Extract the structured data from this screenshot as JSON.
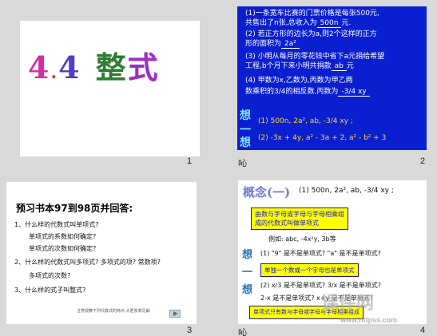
{
  "slides": [
    {
      "number": "1",
      "title_parts": [
        "4",
        ".",
        "4",
        "整",
        "式"
      ]
    },
    {
      "number": "2",
      "lines": [
        "(1)一条宽车比赛的门票价格是每张",
        "共售出了n张,总收入为",
        "(2) 若正方形的边长为a,则2个这样的正方",
        "形的面积为",
        "(3) 小明从每月的零花钱中省下a元捐给希望",
        "工程,b个月下来小明共捐款",
        "(4) 甲数为x,乙数为,丙数为甲乙两",
        "数乘积的",
        "的相反数,丙数为"
      ],
      "values": {
        "price": "500元,",
        "revenue": "500n",
        "revenue_unit": "元.",
        "area": "2a²",
        "donation": "ab",
        "donation_unit": "元",
        "frac": "3/4",
        "product": "-3/4 xy"
      },
      "answers": [
        "(1)  500n, 2a², ab, -3/4 xy ;",
        "(2) -3x + 4y, a² - 3a + 2, a² - b² + 3"
      ],
      "side_labels": [
        "想",
        "一",
        "想"
      ],
      "note": "吣"
    },
    {
      "number": "3",
      "heading": "预习书本97到98页并回答:",
      "questions": [
        "1、什么样的代数式叫单项式?",
        "单项式的系数如何确定?",
        "单项式的次数如何确定?",
        "2、什么样的代数式叫多项式? 多项式的项? 常数项?",
        "多项式的次数?",
        "3、什么样的式子叫整式?"
      ],
      "footer": "注意观察下列代数式的特点 大胆发表见解"
    },
    {
      "number": "4",
      "concept_label": "概念(一)",
      "concept_values": "(1)  500n, 2a², ab, -3/4 xy ;",
      "definition_line1": "由数与字母或字母与字母相乘组",
      "definition_line2": "成的代数式叫做单项式",
      "example": "例如: abc, -4x²y, 3b等",
      "q1": "(1) \"9\" 是不是单项式? \"a\" 是不是单项式?",
      "answer1": "单独一个数或一个字母也是单项式",
      "q2": "(2) x/3 是不是单项式? 3/x 是不是单项式?",
      "q3": "2-x 是不是单项式? x+y 是不是单项式?",
      "answer2": "单项式只有数与字母或字母与字母相乘组成",
      "side_labels": [
        "想",
        "一",
        "想"
      ],
      "watermark_main": "课件网",
      "watermark_url": "www.httpss.com",
      "note": "吣"
    }
  ]
}
